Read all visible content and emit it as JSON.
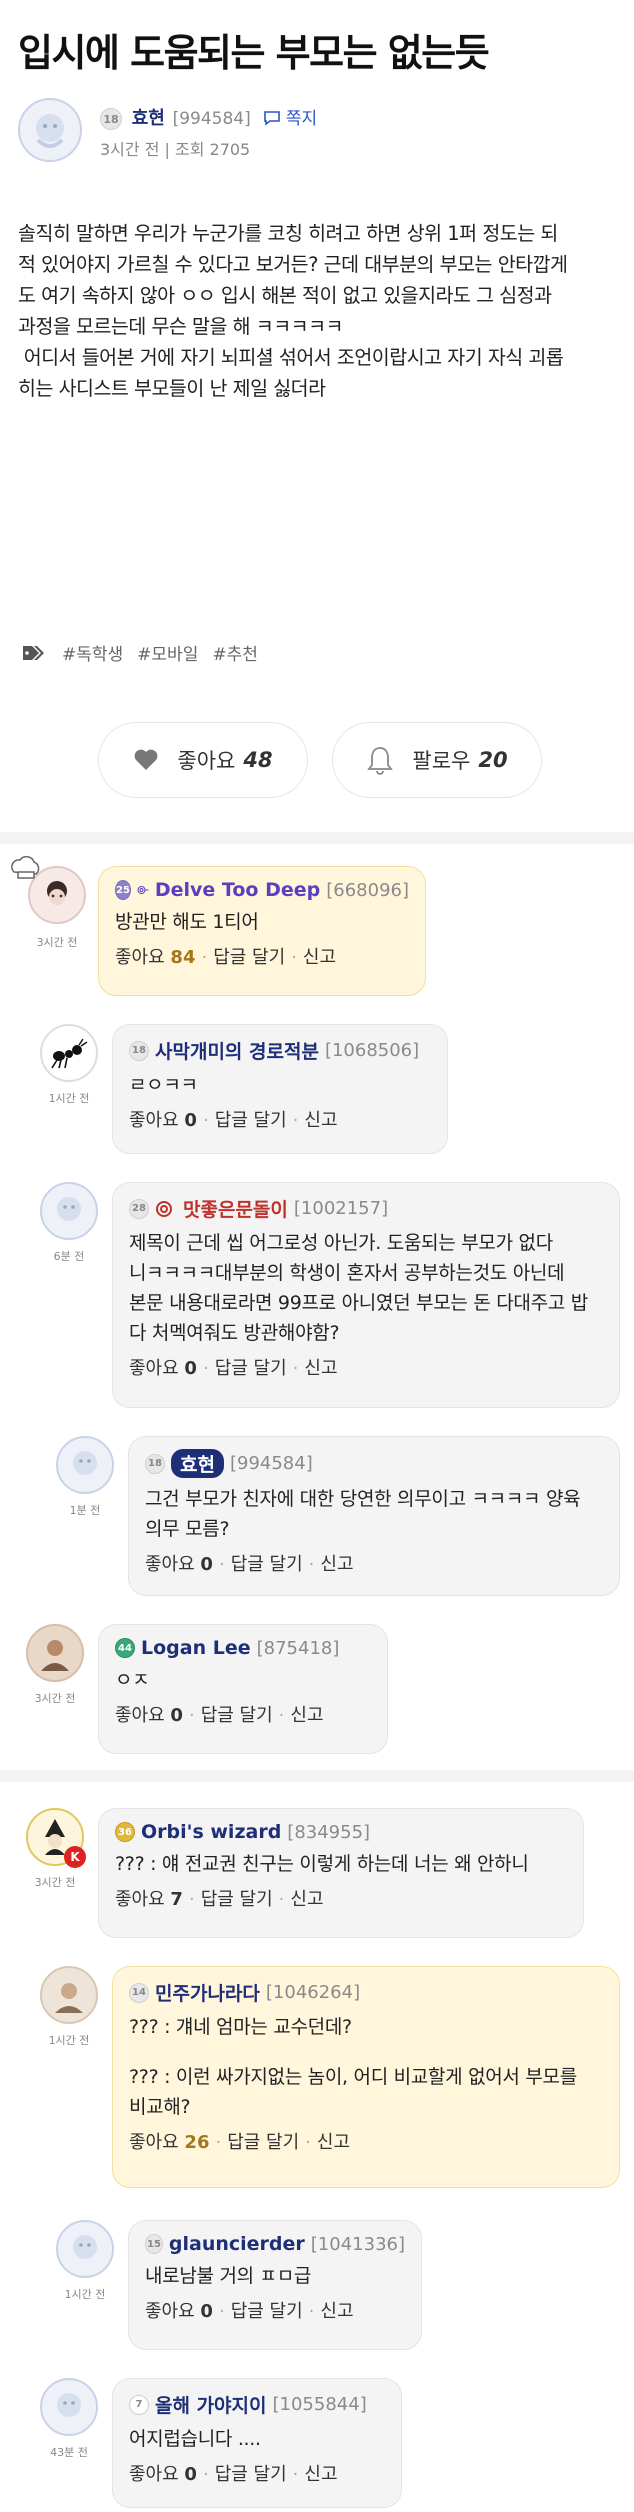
{
  "post": {
    "title": "입시에 도움되는 부모는 없는듯",
    "author": {
      "level": "18",
      "nickname": "효현",
      "uid": "[994584]",
      "message_label": "쪽지"
    },
    "meta": "3시간 전 | 조회 2705",
    "body_lines": [
      "솔직히 말하면 우리가 누군가를 코칭 히려고 하면 상위 1퍼 정도는 되",
      "적 있어야지 가르칠 수 있다고 보거든? 근데 대부분의 부모는 안타깝게",
      "도 여기 속하지 않아 ㅇㅇ 입시 해본 적이 없고 있을지라도 그 심정과",
      "과정을 모르는데 무슨 말을 해 ㅋㅋㅋㅋㅋ",
      " 어디서 들어본 거에 자기 뇌피셜 섞어서 조언이랍시고 자기 자식 괴롭",
      "히는 사디스트 부모들이 난 제일 싫더라"
    ],
    "tags": [
      "#독학생",
      "#모바일",
      "#추천"
    ],
    "like_label": "좋아요",
    "like_count": "48",
    "follow_label": "팔로우",
    "follow_count": "20"
  },
  "comment_actions": {
    "like": "좋아요",
    "reply": "답글 달기",
    "report": "신고"
  },
  "comments": [
    {
      "time": "3시간 전",
      "level": "25",
      "nickname": "Delve Too Deep",
      "uid": "[668096]",
      "text": "방관만 해도 1티어",
      "likes": "84",
      "best": true
    },
    {
      "time": "1시간 전",
      "level": "18",
      "nickname": "사막개미의 경로적분",
      "uid": "[1068506]",
      "text": "ㄹㅇㅋㅋ",
      "likes": "0"
    },
    {
      "time": "6분 전",
      "level": "28",
      "nickname": "맛좋은문돌이",
      "uid": "[1002157]",
      "text": "제목이 근데 씹 어그로성 아닌가. 도움되는 부모가 없다 니ㅋㅋㅋㅋ대부분의 학생이 혼자서 공부하는것도 아닌데 본문 내용대로라면 99프로 아니였던 부모는 돈 다대주고 밥 다 처멕여줘도 방관해야함?",
      "likes": "0"
    },
    {
      "time": "1분 전",
      "level": "18",
      "nickname": "효현",
      "uid": "[994584]",
      "text": "그건 부모가 친자에 대한 당연한 의무이고 ㅋㅋㅋㅋ 양육 의무 모름?",
      "likes": "0"
    },
    {
      "time": "3시간 전",
      "level": "44",
      "nickname": "Logan Lee",
      "uid": "[875418]",
      "text": "ㅇㅈ",
      "likes": "0"
    },
    {
      "time": "3시간 전",
      "level": "36",
      "nickname": "Orbi's wizard",
      "uid": "[834955]",
      "text": "??? : 얘 전교권 친구는 이렇게 하는데 너는 왜 안하니",
      "likes": "7"
    },
    {
      "time": "1시간 전",
      "level": "14",
      "nickname": "민주가나라다",
      "uid": "[1046264]",
      "text": "??? : 걔네 엄마는 교수던데?",
      "text2": "??? : 이런 싸가지없는 놈이, 어디 비교할게 없어서 부모를 비교해?",
      "likes": "26",
      "best": true
    },
    {
      "time": "1시간 전",
      "level": "15",
      "nickname": "glauncierder",
      "uid": "[1041336]",
      "text": "내로남불 거의 ㅍㅁ급",
      "likes": "0"
    },
    {
      "time": "43분 전",
      "level": "7",
      "nickname": "올해 가야지이",
      "uid": "[1055844]",
      "text": "어지럽습니다 ....",
      "likes": "0"
    }
  ],
  "colors": {
    "nick": "#1e2f78",
    "best_bubble": "#fff6dc",
    "bubble": "#f4f4f4",
    "purple_nick": "#5a3fc0",
    "red_nick": "#c0312b"
  },
  "icons": [
    "tag-icon",
    "heart-icon",
    "bell-icon",
    "message-icon"
  ]
}
